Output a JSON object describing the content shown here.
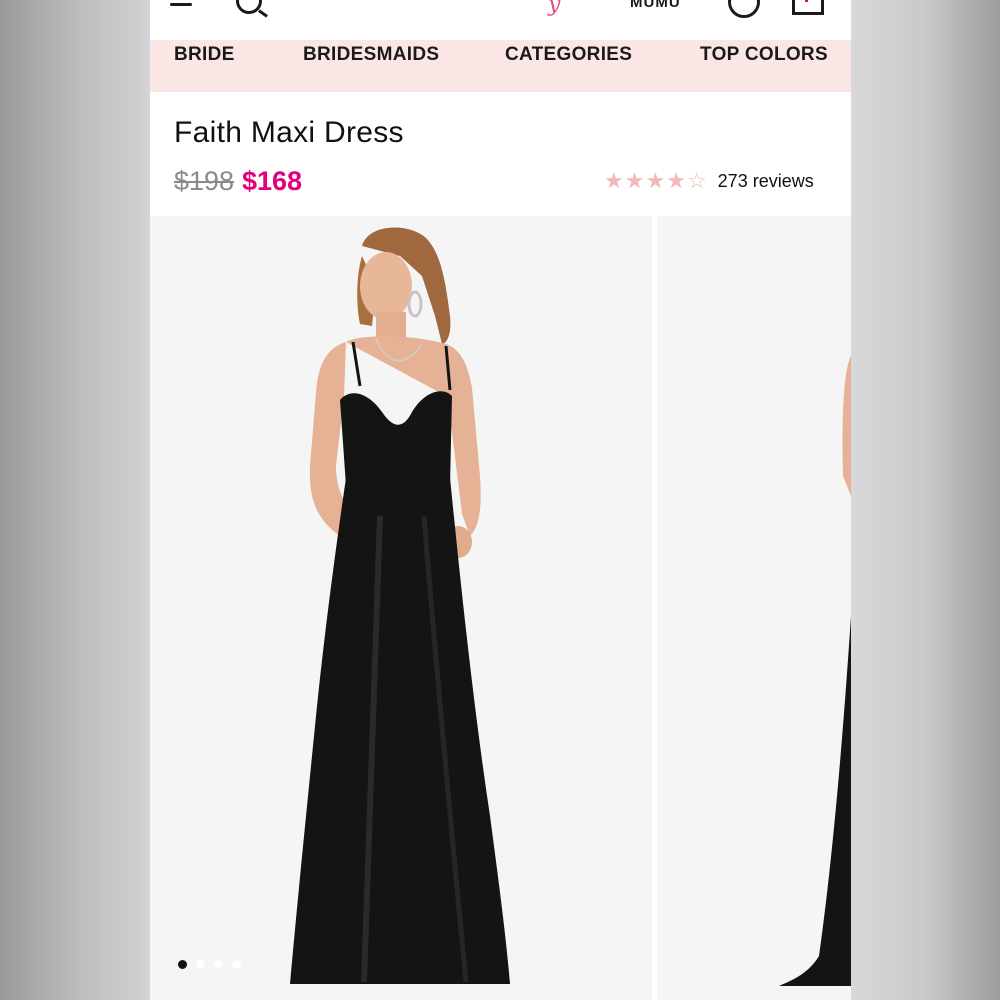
{
  "header": {
    "brand": "MUMU",
    "logo_mark": "y",
    "icons": [
      "menu-icon",
      "search-icon",
      "account-icon",
      "cart-icon"
    ]
  },
  "nav": {
    "items": [
      {
        "label": "BRIDE"
      },
      {
        "label": "BRIDESMAIDS"
      },
      {
        "label": "CATEGORIES"
      },
      {
        "label": "TOP COLORS"
      }
    ]
  },
  "product": {
    "title": "Faith Maxi Dress",
    "original_price": "$198",
    "sale_price": "$168",
    "rating": 4,
    "rating_max": 5,
    "reviews": "273 reviews"
  },
  "gallery": {
    "slide_count": 4,
    "active_index": 0
  },
  "colors": {
    "accent": "#e4007c",
    "nav_bg": "#fbe6e6",
    "star": "#f3b8b8",
    "dress": "#141414"
  }
}
